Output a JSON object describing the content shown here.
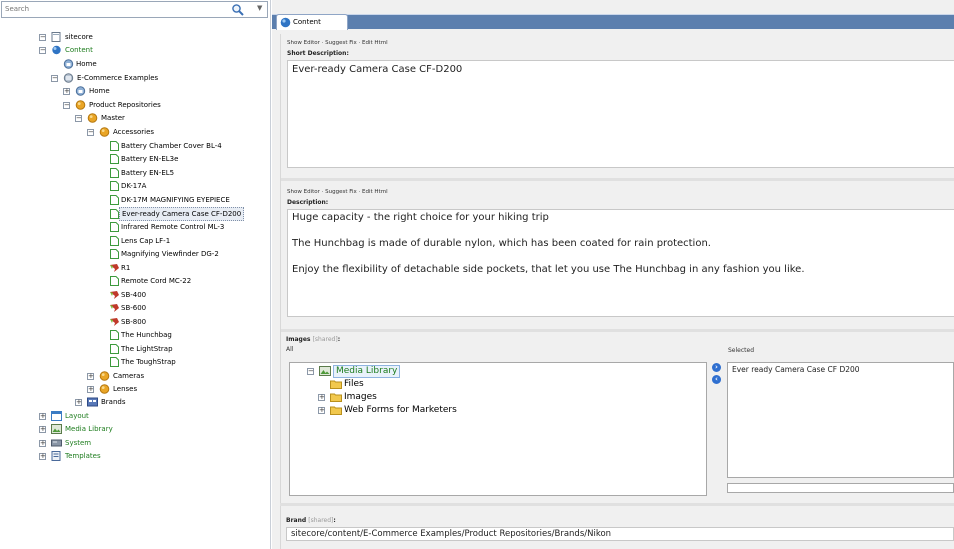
{
  "search": {
    "placeholder": "Search"
  },
  "tree": {
    "sitecore": "sitecore",
    "content": "Content",
    "home": "Home",
    "ecommerce": "E-Commerce Examples",
    "ec_home": "Home",
    "product_repositories": "Product Repositories",
    "master": "Master",
    "accessories": "Accessories",
    "items": [
      "Battery Chamber Cover BL-4",
      "Battery EN-EL3e",
      "Battery EN-EL5",
      "DK-17A",
      "DK-17M MAGNIFYING EYEPIECE",
      "Ever-ready Camera Case CF-D200",
      "Infrared Remote Control ML-3",
      "Lens Cap LF-1",
      "Magnifying Viewfinder DG-2",
      "R1",
      "Remote Cord MC-22",
      "SB-400",
      "SB-600",
      "SB-800",
      "The Hunchbag",
      "The LightStrap",
      "The ToughStrap"
    ],
    "cameras": "Cameras",
    "lenses": "Lenses",
    "brands": "Brands",
    "layout": "Layout",
    "media_library": "Media Library",
    "system": "System",
    "templates": "Templates"
  },
  "tabs": {
    "content": "Content"
  },
  "editor": {
    "links": "Show Editor · Suggest Fix · Edit Html",
    "short_label": "Short Description:",
    "short_value": "Ever-ready Camera Case CF-D200",
    "desc_label": "Description:",
    "desc_lines": [
      "Huge capacity - the right choice for your hiking trip",
      "The Hunchbag is made of durable nylon, which has been coated for rain protection.",
      "Enjoy the flexibility of detachable side pockets, that let you use The Hunchbag in any fashion you like."
    ],
    "images_label": "Images",
    "shared": "[shared]",
    "colon": ":",
    "all_label": "All",
    "selected_label": "Selected",
    "media_tree": [
      "Media Library",
      "Files",
      "Images",
      "Web Forms for Marketers"
    ],
    "selected_item": "Ever ready Camera Case CF D200",
    "brand_label": "Brand",
    "brand_value": "sitecore/content/E-Commerce Examples/Product Repositories/Brands/Nikon"
  },
  "colors": {
    "tabbar": "#5c7fae",
    "green_text": "#1d7c1d",
    "arrow_blue": "#2f6fd0"
  }
}
